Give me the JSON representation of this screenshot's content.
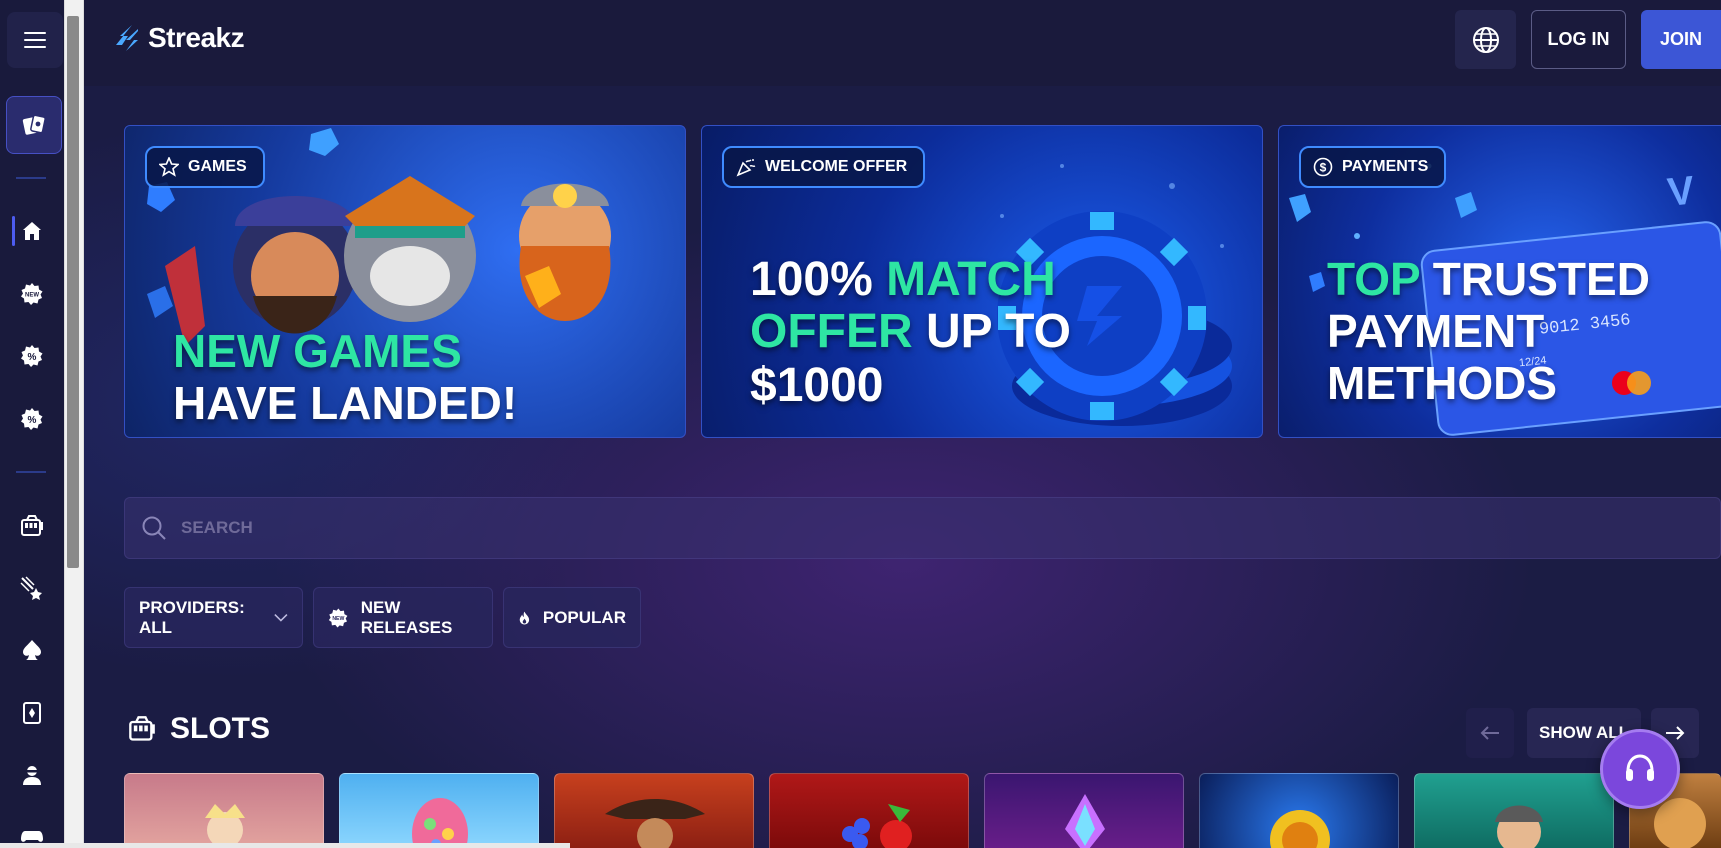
{
  "brand": {
    "name": "Streakz"
  },
  "header": {
    "login_label": "LOG IN",
    "join_label": "JOIN"
  },
  "banners": [
    {
      "tag": "GAMES",
      "line1": "NEW GAMES",
      "line2": "HAVE LANDED!"
    },
    {
      "tag": "WELCOME OFFER",
      "line1a": "100%",
      "line1b": "MATCH",
      "line2a": "OFFER",
      "line2b": "UP TO",
      "line3": "$1000"
    },
    {
      "tag": "PAYMENTS",
      "line1a": "TOP",
      "line1b": "TRUSTED",
      "line2": "PAYMENT",
      "line3": "METHODS",
      "card_number": "9012 3456",
      "card_expiry": "12/24"
    }
  ],
  "search": {
    "placeholder": "SEARCH"
  },
  "filters": {
    "providers": "PROVIDERS: ALL",
    "new_releases": "NEW RELEASES",
    "popular": "POPULAR"
  },
  "slots": {
    "title": "SLOTS",
    "show_all": "SHOW ALL"
  },
  "colors": {
    "accent": "#3c56d6",
    "highlight_green": "#2ee6a3",
    "support": "#7b47dc",
    "background": "#1b1c44"
  },
  "icons": {
    "rail": [
      "menu-icon",
      "cards-icon",
      "home-icon",
      "new-badge-icon",
      "percent-icon",
      "percent-icon",
      "slot-machine-icon",
      "shooting-star-icon",
      "spade-icon",
      "playing-card-icon",
      "dealer-icon",
      "gamepad-icon"
    ]
  }
}
